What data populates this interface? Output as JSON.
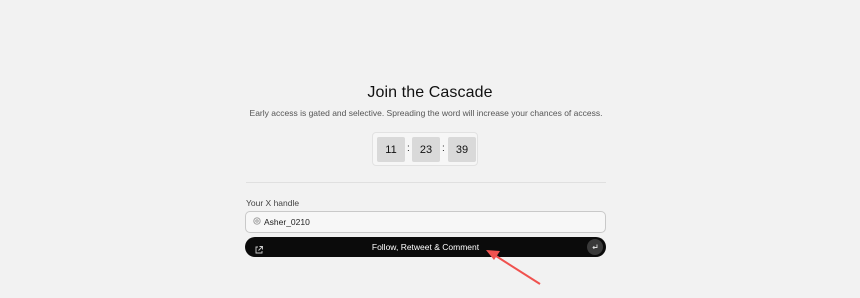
{
  "heading": "Join the Cascade",
  "subheading": "Early access is gated and selective. Spreading the word will increase your chances of access.",
  "countdown": {
    "hours": "11",
    "minutes": "23",
    "seconds": "39",
    "separator": ":"
  },
  "handle_field": {
    "label": "Your X handle",
    "prefix_icon": "at-icon",
    "value": "Asher_0210"
  },
  "cta": {
    "label": "Follow, Retweet & Comment",
    "left_icon": "external-link-icon",
    "right_icon": "enter-icon"
  },
  "annotation": {
    "type": "arrow",
    "color": "#f0524f"
  }
}
